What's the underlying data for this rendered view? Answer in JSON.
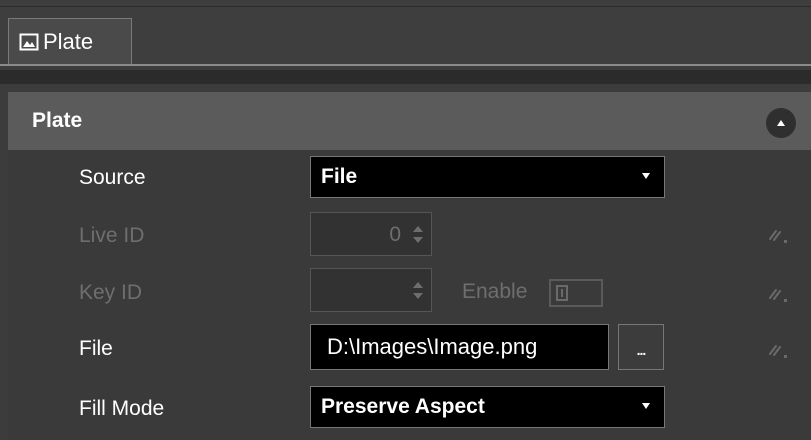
{
  "tab": {
    "label": "Plate",
    "icon": "image-icon"
  },
  "section": {
    "title": "Plate",
    "collapse_icon": "chevron-up-icon"
  },
  "fields": {
    "source": {
      "label": "Source",
      "value": "File"
    },
    "live_id": {
      "label": "Live ID",
      "value": "0"
    },
    "key_id": {
      "label": "Key ID",
      "value": "",
      "enable_label": "Enable"
    },
    "file": {
      "label": "File",
      "value": "D:\\Images\\Image.png",
      "browse_label": "..."
    },
    "fill_mode": {
      "label": "Fill Mode",
      "value": "Preserve Aspect"
    }
  },
  "icons": {
    "link": "link-icon"
  },
  "colors": {
    "background": "#3c3c3c",
    "header": "#5b5b5b",
    "input": "#000000",
    "disabled_text": "#6e6e6e"
  }
}
